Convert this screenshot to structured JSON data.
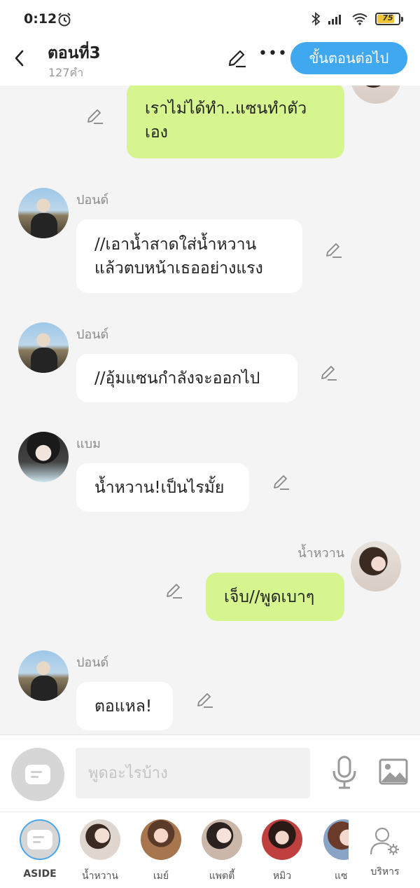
{
  "status_bar": {
    "time": "0:12",
    "battery": "75"
  },
  "header": {
    "title": "ตอนที่3",
    "word_count": "127คำ",
    "next_button": "ขั้นตอนต่อไป"
  },
  "messages": [
    {
      "side": "right",
      "sender": "",
      "text": "เราไม่ได้ทำ..แซนทำตัวเอง"
    },
    {
      "side": "left",
      "sender": "ปอนด์",
      "text": "//เอาน้ำสาดใส่น้ำหวานแล้วตบหน้าเธออย่างแรง"
    },
    {
      "side": "left",
      "sender": "ปอนด์",
      "text": "//อุ้มแซนกำลังจะออกไป"
    },
    {
      "side": "left",
      "sender": "แบม",
      "text": "น้ำหวาน!เป็นไรมั้ย"
    },
    {
      "side": "right",
      "sender": "น้ำหวาน",
      "text": "เจ็บ//พูดเบาๆ"
    },
    {
      "side": "left",
      "sender": "ปอนด์",
      "text": "ตอแหล!"
    }
  ],
  "input": {
    "placeholder": "พูดอะไรบ้าง"
  },
  "characters": [
    {
      "name": "ASIDE"
    },
    {
      "name": "น้ำหวาน"
    },
    {
      "name": "เมย์"
    },
    {
      "name": "แพตตี้"
    },
    {
      "name": "หมิว"
    },
    {
      "name": "แซ"
    }
  ],
  "manage_label": "บริหาร",
  "colors": {
    "accent": "#3fa8ef",
    "my_bubble": "#d6f58f",
    "other_bubble": "#ffffff"
  }
}
